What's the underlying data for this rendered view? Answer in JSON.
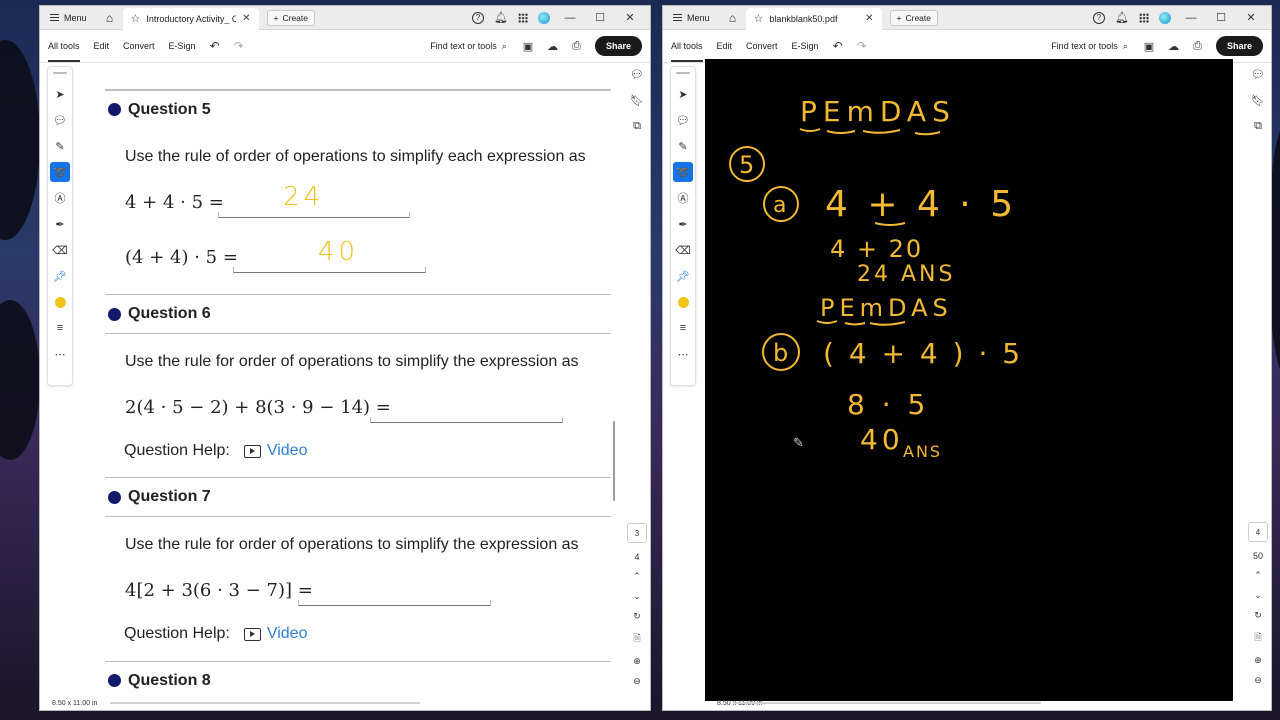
{
  "left_window": {
    "menu_label": "Menu",
    "tab_title": "Introductory Activity_ Or...",
    "create_label": "Create",
    "toolbar": {
      "all_tools": "All tools",
      "edit": "Edit",
      "convert": "Convert",
      "esign": "E-Sign",
      "find": "Find text or tools",
      "share": "Share"
    },
    "page_nav": {
      "current": "3",
      "total": "4"
    },
    "page_size": "8.50 x 11.00 in",
    "document": {
      "questions": [
        {
          "title": "Question 5",
          "prompt": "Use the rule of order of operations to simplify each expression as",
          "items": [
            {
              "expr": "4 + 4 · 5 =",
              "answer": "24"
            },
            {
              "expr": "(4 + 4) · 5 =",
              "answer": "40"
            }
          ]
        },
        {
          "title": "Question 6",
          "prompt": "Use the rule for order of operations to simplify the expression as",
          "expr": "2(4 · 5 − 2) + 8(3 · 9 − 14) =",
          "help_label": "Question Help:",
          "video_label": "Video"
        },
        {
          "title": "Question 7",
          "prompt": "Use the rule for order of operations to simplify the expression as",
          "expr": "4[2 + 3(6 · 3 − 7)] =",
          "help_label": "Question Help:",
          "video_label": "Video"
        },
        {
          "title": "Question 8"
        }
      ]
    }
  },
  "right_window": {
    "menu_label": "Menu",
    "tab_title": "blankblank50.pdf",
    "create_label": "Create",
    "toolbar": {
      "all_tools": "All tools",
      "edit": "Edit",
      "convert": "Convert",
      "esign": "E-Sign",
      "find": "Find text or tools",
      "share": "Share"
    },
    "page_nav": {
      "current": "4",
      "total": "50"
    },
    "page_size": "8.50 x 11.00 in",
    "handwriting": {
      "pemdas_1": "PEmDAS",
      "question_num": "5",
      "part_a": "a",
      "a_expr": "4 + 4 · 5",
      "a_step1": "4 + 20",
      "a_step2": "24 ANS",
      "pemdas_2": "PEmDAS",
      "part_b": "b",
      "b_expr": "( 4 + 4 ) · 5",
      "b_step1": "8 · 5",
      "b_answer": "40",
      "b_ans_label": "ANS"
    }
  },
  "colors": {
    "ink": "#f2b933",
    "bullet": "#111a6b",
    "link": "#2f7fd6",
    "tool_selected": "#1473e6"
  }
}
